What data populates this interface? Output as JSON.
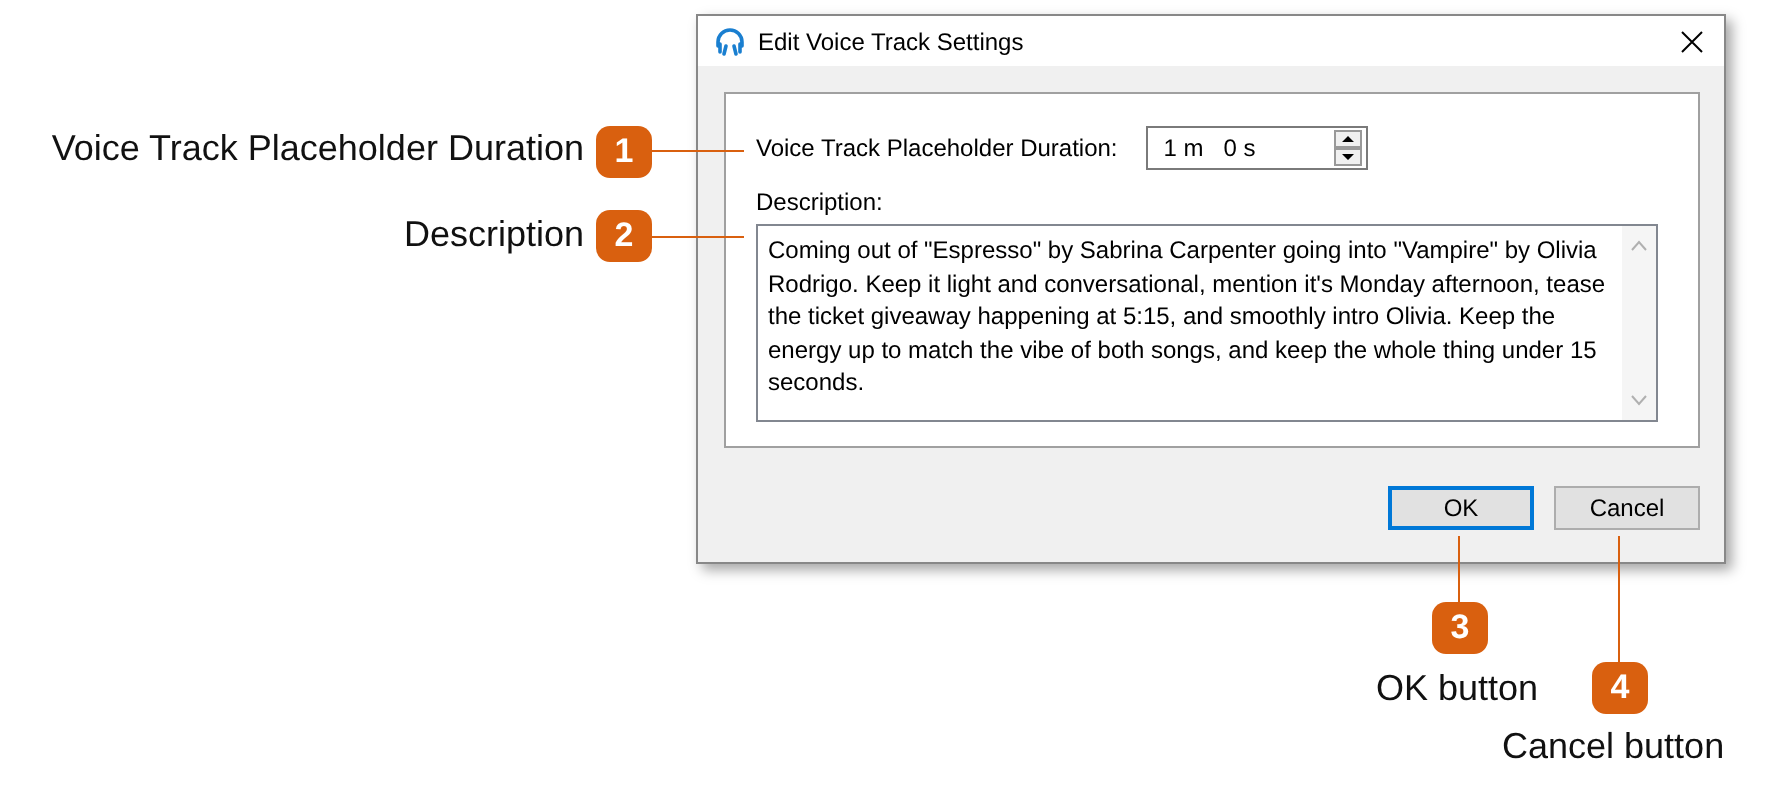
{
  "dialog": {
    "title": "Edit Voice Track Settings",
    "duration_label": "Voice Track Placeholder Duration:",
    "duration_value": "1 m   0 s",
    "description_label": "Description:",
    "description_text": "Coming out of \"Espresso\" by Sabrina Carpenter going into \"Vampire\" by Olivia Rodrigo. Keep it light and conversational, mention it's Monday afternoon, tease the ticket giveaway happening at 5:15, and smoothly intro Olivia. Keep the energy up to match the vibe of both songs, and keep the whole thing under 15 seconds.",
    "buttons": [
      {
        "label": "OK",
        "focused": true
      },
      {
        "label": "Cancel",
        "focused": false
      }
    ]
  },
  "callouts": [
    {
      "number": "1",
      "label": "Voice Track Placeholder Duration"
    },
    {
      "number": "2",
      "label": "Description"
    },
    {
      "number": "3",
      "label": "OK button"
    },
    {
      "number": "4",
      "label": "Cancel button"
    }
  ]
}
